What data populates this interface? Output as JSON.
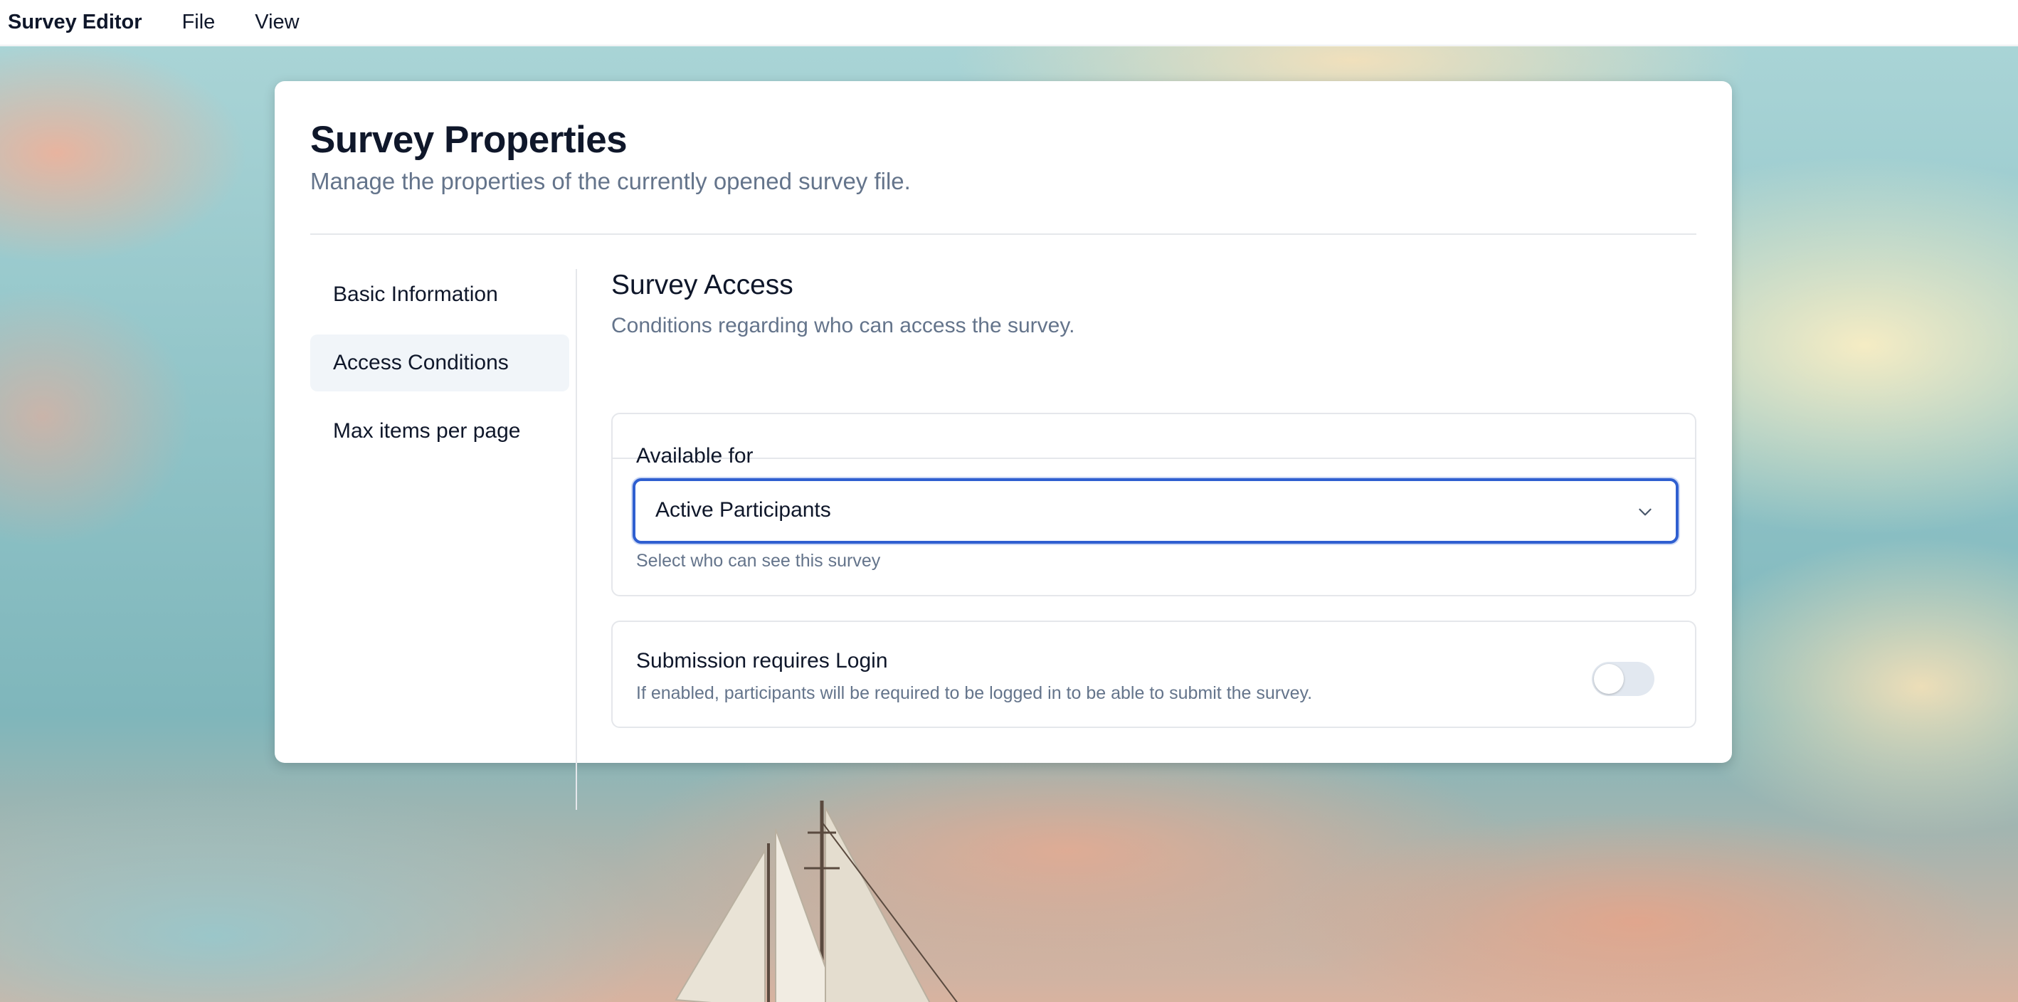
{
  "menubar": {
    "app_name": "Survey Editor",
    "items": [
      {
        "label": "File"
      },
      {
        "label": "View"
      }
    ]
  },
  "page": {
    "title": "Survey Properties",
    "subtitle": "Manage the properties of the currently opened survey file."
  },
  "nav": {
    "items": [
      {
        "label": "Basic Information",
        "active": false
      },
      {
        "label": "Access Conditions",
        "active": true
      },
      {
        "label": "Max items per page",
        "active": false
      }
    ]
  },
  "section": {
    "title": "Survey Access",
    "description": "Conditions regarding who can access the survey."
  },
  "available_for": {
    "label": "Available for",
    "selected_value": "Active Participants",
    "help": "Select who can see this survey"
  },
  "login_requirement": {
    "label": "Submission requires Login",
    "description": "If enabled, participants will be required to be logged in to be able to submit the survey.",
    "enabled": false
  },
  "icons": {
    "select_chevron": "chevron-down-icon"
  },
  "colors": {
    "focus_ring": "#2f5fd0",
    "muted_text": "#64748b",
    "active_nav_bg": "#f1f5f9",
    "toggle_off": "#e2e8f0"
  }
}
